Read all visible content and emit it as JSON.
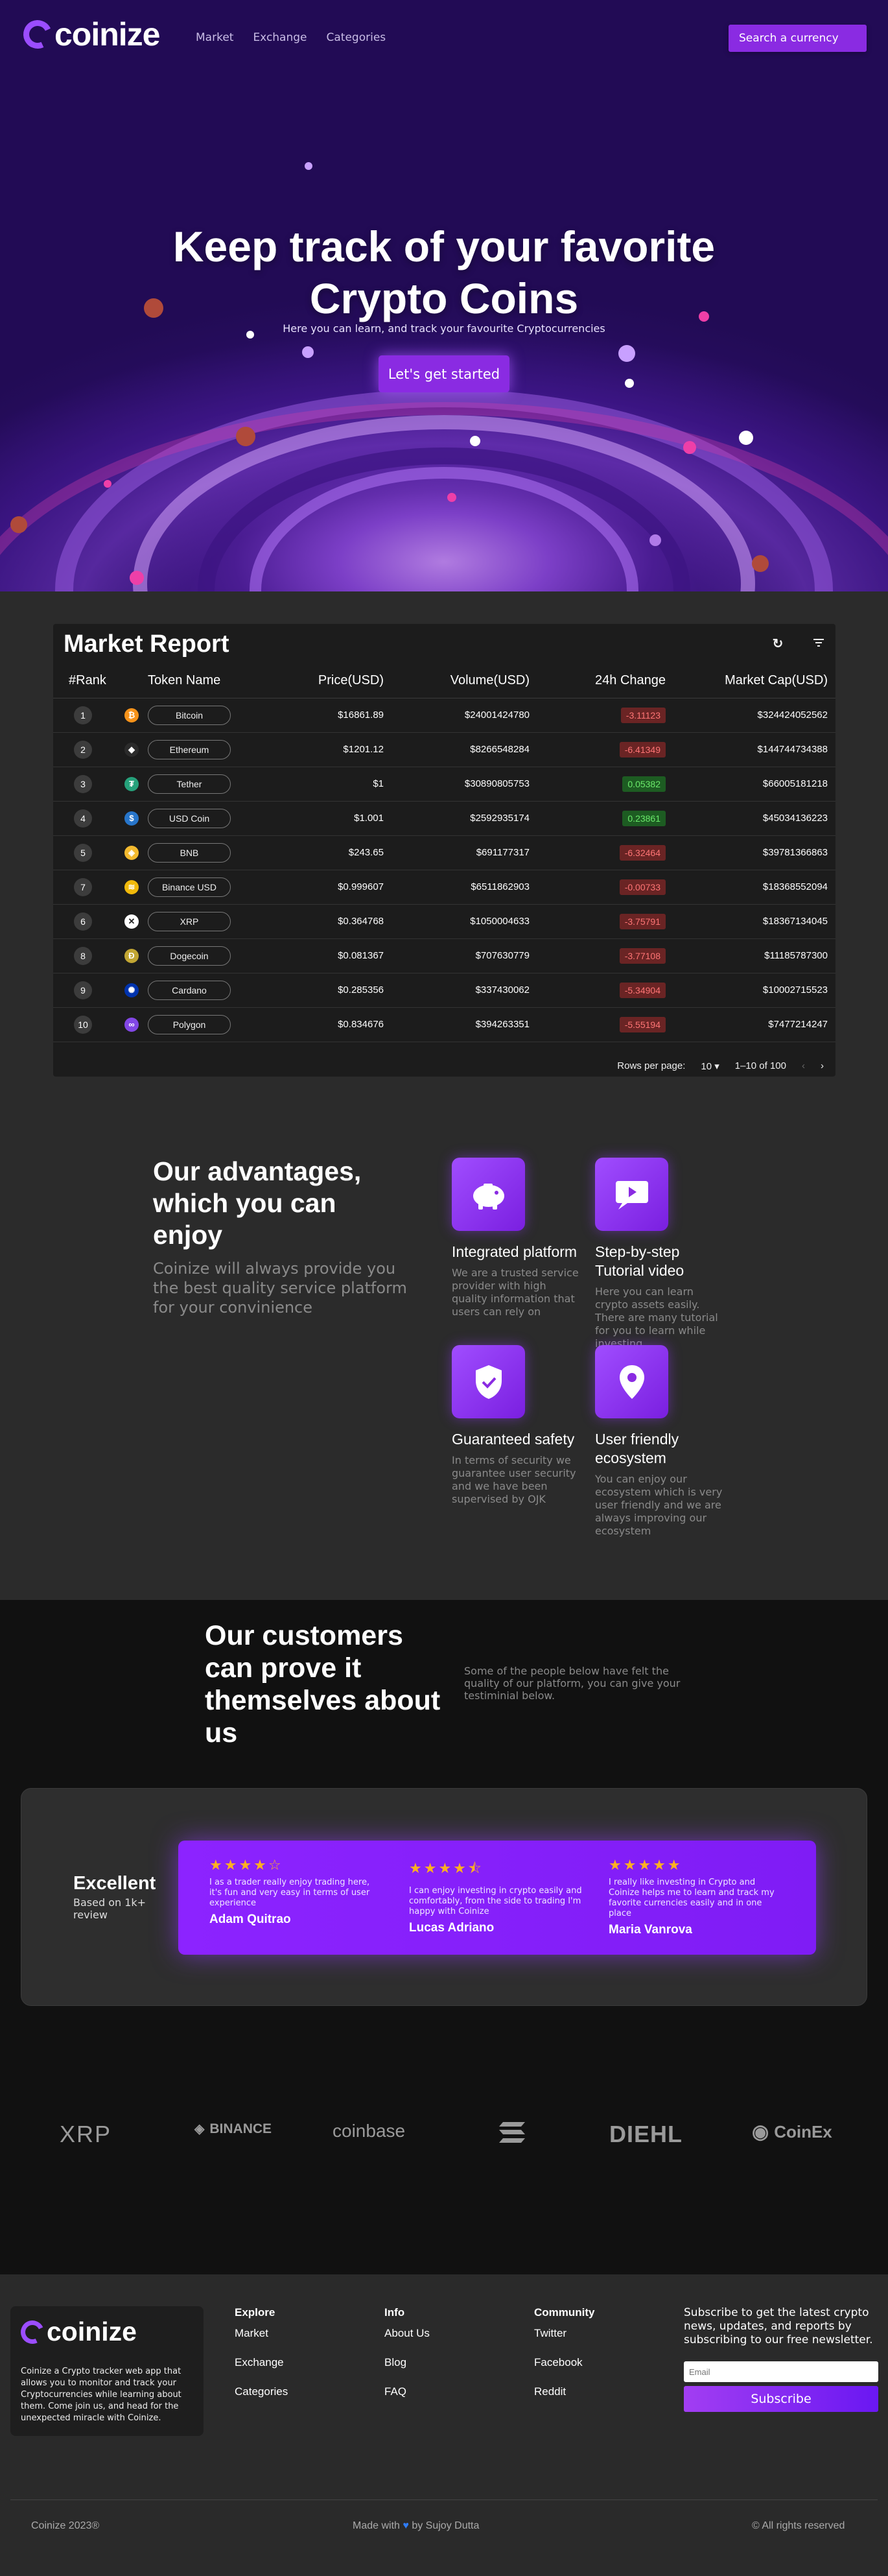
{
  "nav": {
    "brand": "coinize",
    "links": [
      "Market",
      "Exchange",
      "Categories"
    ],
    "search_label": "Search a currency"
  },
  "hero": {
    "title_line1": "Keep track of your favorite",
    "title_line2": "Crypto Coins",
    "subtitle": "Here you can learn, and track your favourite Cryptocurrencies",
    "cta": "Let's get started"
  },
  "market": {
    "title": "Market Report",
    "columns": [
      "#Rank",
      "Token Name",
      "Price(USD)",
      "Volume(USD)",
      "24h Change",
      "Market Cap(USD)"
    ],
    "rows": [
      {
        "rank": "1",
        "name": "Bitcoin",
        "price": "$16861.89",
        "volume": "$24001424780",
        "change": "-3.11123",
        "cap": "$324424052562",
        "dir": "neg",
        "icon": "bitcoin-icon",
        "color": "#f7931a",
        "glyph": "₿"
      },
      {
        "rank": "2",
        "name": "Ethereum",
        "price": "$1201.12",
        "volume": "$8266548284",
        "change": "-6.41349",
        "cap": "$144744734388",
        "dir": "neg",
        "icon": "ethereum-icon",
        "color": "#2b2b2b",
        "glyph": "◆"
      },
      {
        "rank": "3",
        "name": "Tether",
        "price": "$1",
        "volume": "$30890805753",
        "change": "0.05382",
        "cap": "$66005181218",
        "dir": "pos",
        "icon": "tether-icon",
        "color": "#26a17b",
        "glyph": "₮"
      },
      {
        "rank": "4",
        "name": "USD Coin",
        "price": "$1.001",
        "volume": "$2592935174",
        "change": "0.23861",
        "cap": "$45034136223",
        "dir": "pos",
        "icon": "usd-coin-icon",
        "color": "#2775ca",
        "glyph": "$"
      },
      {
        "rank": "5",
        "name": "BNB",
        "price": "$243.65",
        "volume": "$691177317",
        "change": "-6.32464",
        "cap": "$39781366863",
        "dir": "neg",
        "icon": "bnb-icon",
        "color": "#f3ba2f",
        "glyph": "◈"
      },
      {
        "rank": "7",
        "name": "Binance USD",
        "price": "$0.999607",
        "volume": "$6511862903",
        "change": "-0.00733",
        "cap": "$18368552094",
        "dir": "neg",
        "icon": "binance-usd-icon",
        "color": "#f0b90b",
        "glyph": "≋"
      },
      {
        "rank": "6",
        "name": "XRP",
        "price": "$0.364768",
        "volume": "$1050004633",
        "change": "-3.75791",
        "cap": "$18367134045",
        "dir": "neg",
        "icon": "xrp-icon",
        "color": "#ffffff",
        "glyph": "✕"
      },
      {
        "rank": "8",
        "name": "Dogecoin",
        "price": "$0.081367",
        "volume": "$707630779",
        "change": "-3.77108",
        "cap": "$11185787300",
        "dir": "neg",
        "icon": "dogecoin-icon",
        "color": "#c2a633",
        "glyph": "Ð"
      },
      {
        "rank": "9",
        "name": "Cardano",
        "price": "$0.285356",
        "volume": "$337430062",
        "change": "-5.34904",
        "cap": "$10002715523",
        "dir": "neg",
        "icon": "cardano-icon",
        "color": "#0033ad",
        "glyph": "✺"
      },
      {
        "rank": "10",
        "name": "Polygon",
        "price": "$0.834676",
        "volume": "$394263351",
        "change": "-5.55194",
        "cap": "$7477214247",
        "dir": "neg",
        "icon": "polygon-icon",
        "color": "#8247e5",
        "glyph": "∞"
      }
    ],
    "rows_per_page_label": "Rows per page:",
    "rows_per_page": "10",
    "range": "1–10 of 100"
  },
  "advantages": {
    "title": "Our advantages, which you can enjoy",
    "subtitle": "Coinize will always provide you the best quality service platform for your convinience",
    "features": [
      {
        "title": "Integrated platform",
        "text": "We are a trusted service provider with high quality information that users can rely on",
        "icon": "piggy-bank-icon"
      },
      {
        "title": "Step-by-step Tutorial video",
        "text": "Here you can learn crypto assets easily. There are many tutorial for you to learn while investing",
        "icon": "video-icon"
      },
      {
        "title": "Guaranteed safety",
        "text": "In terms of security we guarantee user security and we have been supervised by OJK",
        "icon": "shield-check-icon"
      },
      {
        "title": "User friendly ecosystem",
        "text": "You can enjoy our ecosystem which is very user friendly and we are always improving our ecosystem",
        "icon": "location-pin-icon"
      }
    ]
  },
  "customers": {
    "title": "Our customers can prove it themselves about us",
    "subtitle": "Some of the people below have felt the quality of our platform, you can give your testiminial below.",
    "summary": {
      "label": "Excellent",
      "sub": "Based on 1k+ review"
    },
    "reviews": [
      {
        "stars": "★★★★☆",
        "text": "I as a trader really enjoy trading here, it's fun and very easy in terms of user experience",
        "name": "Adam Quitrao"
      },
      {
        "stars": "★★★★⯪",
        "text": "I can enjoy investing in crypto easily and comfortably, from the side to trading I'm happy with Coinize",
        "name": "Lucas Adriano"
      },
      {
        "stars": "★★★★★",
        "text": "I really like investing in Crypto and Coinize helps me to learn and track my favorite currencies easily and in one place",
        "name": "Maria Vanrova"
      }
    ]
  },
  "partners": [
    {
      "name": "XRP",
      "icon": "xrp-logo-icon"
    },
    {
      "name": "BINANCE",
      "icon": "binance-logo-icon"
    },
    {
      "name": "coinbase",
      "icon": "coinbase-logo-icon"
    },
    {
      "name": "",
      "icon": "solana-logo-icon"
    },
    {
      "name": "DIEHL",
      "icon": "diehl-logo-icon"
    },
    {
      "name": "CoinEx",
      "icon": "coinex-logo-icon"
    }
  ],
  "footer": {
    "brand": "coinize",
    "description": "Coinize a Crypto tracker web app that allows you to monitor and track your Cryptocurrencies while learning about them. Come join us, and head for the unexpected miracle with Coinize.",
    "cols": [
      {
        "title": "Explore",
        "links": [
          "Market",
          "Exchange",
          "Categories"
        ]
      },
      {
        "title": "Info",
        "links": [
          "About Us",
          "Blog",
          "FAQ"
        ]
      },
      {
        "title": "Community",
        "links": [
          "Twitter",
          "Facebook",
          "Reddit"
        ]
      }
    ],
    "newsletter": "Subscribe to get the latest crypto news, updates, and reports by subscribing to our free newsletter.",
    "email_placeholder": "Email",
    "subscribe": "Subscribe",
    "copyright": "Coinize 2023®",
    "made_with": "Made with",
    "made_by": "by Sujoy Dutta",
    "rights": "© All rights reserved"
  },
  "colors": {
    "accent": "#8a2be2",
    "negative": "#ff7575",
    "positive": "#6bea6b",
    "heart": "#2f7cf6"
  }
}
